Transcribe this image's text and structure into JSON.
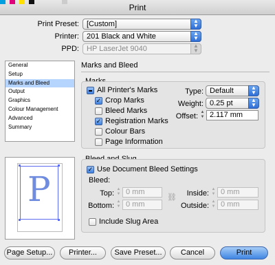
{
  "window": {
    "title": "Print"
  },
  "header": {
    "preset_label": "Print Preset:",
    "preset_value": "[Custom]",
    "printer_label": "Printer:",
    "printer_value": "201 Black and White",
    "ppd_label": "PPD:",
    "ppd_value": "HP LaserJet 9040"
  },
  "sidebar": {
    "items": [
      {
        "label": "General"
      },
      {
        "label": "Setup"
      },
      {
        "label": "Marks and Bleed"
      },
      {
        "label": "Output"
      },
      {
        "label": "Graphics"
      },
      {
        "label": "Colour Management"
      },
      {
        "label": "Advanced"
      },
      {
        "label": "Summary"
      }
    ],
    "selected": "Marks and Bleed"
  },
  "preview": {
    "glyph": "P"
  },
  "panel": {
    "title": "Marks and Bleed",
    "marks": {
      "heading": "Marks",
      "all_printers_marks": "All Printer's Marks",
      "crop_marks": "Crop Marks",
      "bleed_marks": "Bleed Marks",
      "registration_marks": "Registration Marks",
      "colour_bars": "Colour Bars",
      "page_information": "Page Information",
      "type_label": "Type:",
      "type_value": "Default",
      "weight_label": "Weight:",
      "weight_value": "0.25 pt",
      "offset_label": "Offset:",
      "offset_value": "2.117 mm"
    },
    "bleed": {
      "heading": "Bleed and Slug",
      "use_document": "Use Document Bleed Settings",
      "bleed_label": "Bleed:",
      "top_label": "Top:",
      "top_value": "0 mm",
      "bottom_label": "Bottom:",
      "bottom_value": "0 mm",
      "inside_label": "Inside:",
      "inside_value": "0 mm",
      "outside_label": "Outside:",
      "outside_value": "0 mm",
      "include_slug": "Include Slug Area"
    }
  },
  "buttons": {
    "page_setup": "Page Setup...",
    "printer": "Printer...",
    "save_preset": "Save Preset...",
    "cancel": "Cancel",
    "print": "Print"
  },
  "colors": {
    "accent": "#3f86e3",
    "selection": "#b5d5ff",
    "preview_glyph": "#6f8cdf"
  }
}
